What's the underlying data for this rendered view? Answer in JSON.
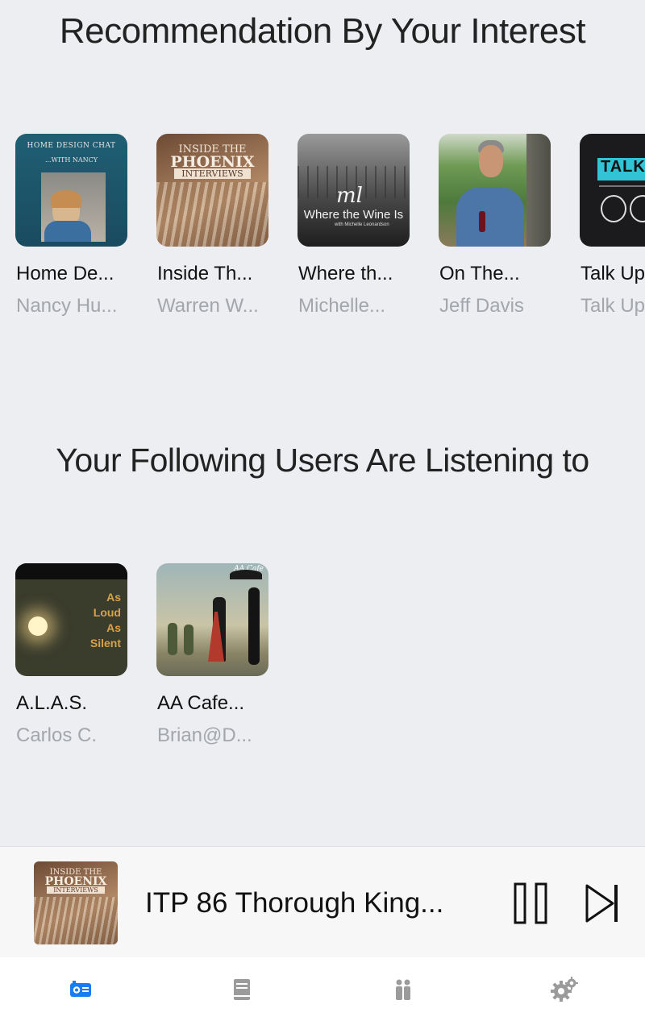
{
  "recommend": {
    "title": "Recommendation By Your Interest",
    "items": [
      {
        "title": "Home De...",
        "author": "Nancy Hu...",
        "cover_lines": [
          "HOME DESIGN CHAT",
          "...WITH NANCY"
        ]
      },
      {
        "title": "Inside Th...",
        "author": "Warren W...",
        "cover_lines": [
          "INSIDE THE",
          "PHOENIX",
          "INTERVIEWS"
        ]
      },
      {
        "title": "Where th...",
        "author": "Michelle...",
        "cover_lines": [
          "ml",
          "Where the Wine Is",
          "with Michelle Leonardson"
        ]
      },
      {
        "title": "On The...",
        "author": "Jeff Davis"
      },
      {
        "title": "Talk Up...",
        "author": "Talk Up...",
        "cover_lines": [
          "TALK"
        ]
      }
    ]
  },
  "following": {
    "title": "Your Following Users Are Listening to",
    "items": [
      {
        "title": "A.L.A.S.",
        "author": "Carlos C.",
        "cover_lines": [
          "As",
          "Loud",
          "As",
          "Silent"
        ]
      },
      {
        "title": "AA Cafe...",
        "author": "Brian@D...",
        "cover_lines": [
          "AA Cafe"
        ]
      }
    ]
  },
  "player": {
    "now_playing": "ITP 86 Thorough King...",
    "thumb_lines": [
      "INSIDE THE",
      "PHOENIX",
      "INTERVIEWS"
    ]
  },
  "icons": {
    "tab_discover": "radio-icon",
    "tab_library": "book-icon",
    "tab_social": "people-icon",
    "tab_settings": "gear-icon",
    "pause": "pause-icon",
    "skip": "skip-forward-icon"
  },
  "colors": {
    "accent": "#1a7cf2",
    "inactive_tab": "#9b9b9b",
    "background": "#eceef1"
  }
}
